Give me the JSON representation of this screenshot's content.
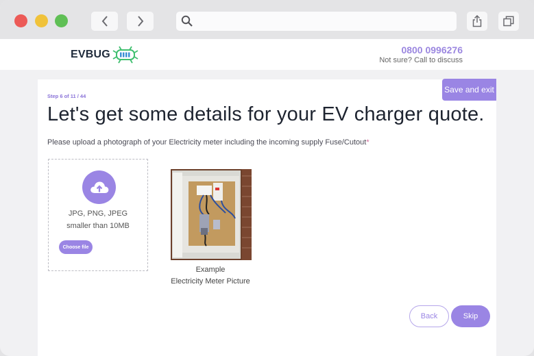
{
  "brand": {
    "name": "EVBUG",
    "accent": "#9a85e4",
    "logo_green": "#3fbf6f"
  },
  "header": {
    "phone": "0800 0996276",
    "phone_sub": "Not sure? Call to discuss"
  },
  "form": {
    "save_exit": "Save and exit",
    "step": "Step 6 of 11 / 44",
    "title": "Let's get some details for your EV charger quote.",
    "instruction": "Please upload a photograph of your Electricity meter including the incoming supply Fuse/Cutout",
    "required_mark": "*",
    "upload": {
      "formats": "JPG, PNG, JPEG",
      "size_limit": "smaller than 10MB",
      "button": "Choose file",
      "icon": "cloud-upload-icon"
    },
    "example": {
      "line1": "Example",
      "line2": "Electricity Meter Picture"
    },
    "back": "Back",
    "skip": "Skip"
  }
}
